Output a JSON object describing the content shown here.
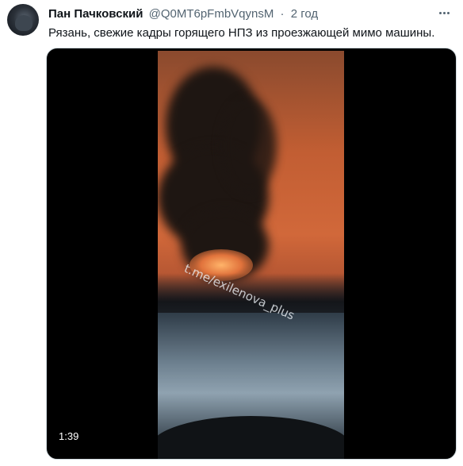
{
  "tweet": {
    "author_name": "Пан Пачковский",
    "handle": "@Q0MT6pFmbVqynsM",
    "separator": "·",
    "time": "2 год",
    "text": "Рязань, свежие кадры горящего НПЗ из проезжающей мимо машины.",
    "avatar_icon": "avatar-photo-icon",
    "more_icon": "more-options-icon"
  },
  "video": {
    "watermark": "t.me/exilenova_plus",
    "duration": "1:39"
  }
}
